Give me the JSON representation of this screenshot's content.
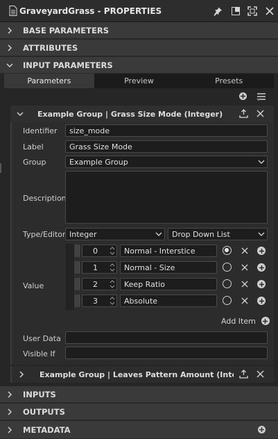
{
  "window": {
    "title": "GraveyardGrass - PROPERTIES"
  },
  "sections": {
    "base": "BASE PARAMETERS",
    "attributes": "ATTRIBUTES",
    "input_params": "INPUT PARAMETERS",
    "inputs": "INPUTS",
    "outputs": "OUTPUTS",
    "metadata": "METADATA"
  },
  "tabs": [
    {
      "label": "Parameters",
      "active": true
    },
    {
      "label": "Preview",
      "active": false
    },
    {
      "label": "Presets",
      "active": false
    }
  ],
  "group1": {
    "title": "Example Group | Grass Size Mode (Integer)",
    "labels": {
      "identifier": "Identifier",
      "label": "Label",
      "group": "Group",
      "description": "Description",
      "type_editor": "Type/Editor",
      "value": "Value",
      "user_data": "User Data",
      "visible_if": "Visible If"
    },
    "identifier": "size_mode",
    "label": "Grass Size Mode",
    "group": "Example Group",
    "description": "",
    "type": "Integer",
    "editor": "Drop Down List",
    "values": [
      {
        "index": "0",
        "text": "Normal - Interstice",
        "selected": true
      },
      {
        "index": "1",
        "text": "Normal - Size",
        "selected": false
      },
      {
        "index": "2",
        "text": "Keep Ratio",
        "selected": false
      },
      {
        "index": "3",
        "text": "Absolute",
        "selected": false
      }
    ],
    "add_item": "Add Item",
    "user_data": "",
    "visible_if": ""
  },
  "group2": {
    "title": "Example Group | Leaves Pattern Amount (Integer"
  }
}
